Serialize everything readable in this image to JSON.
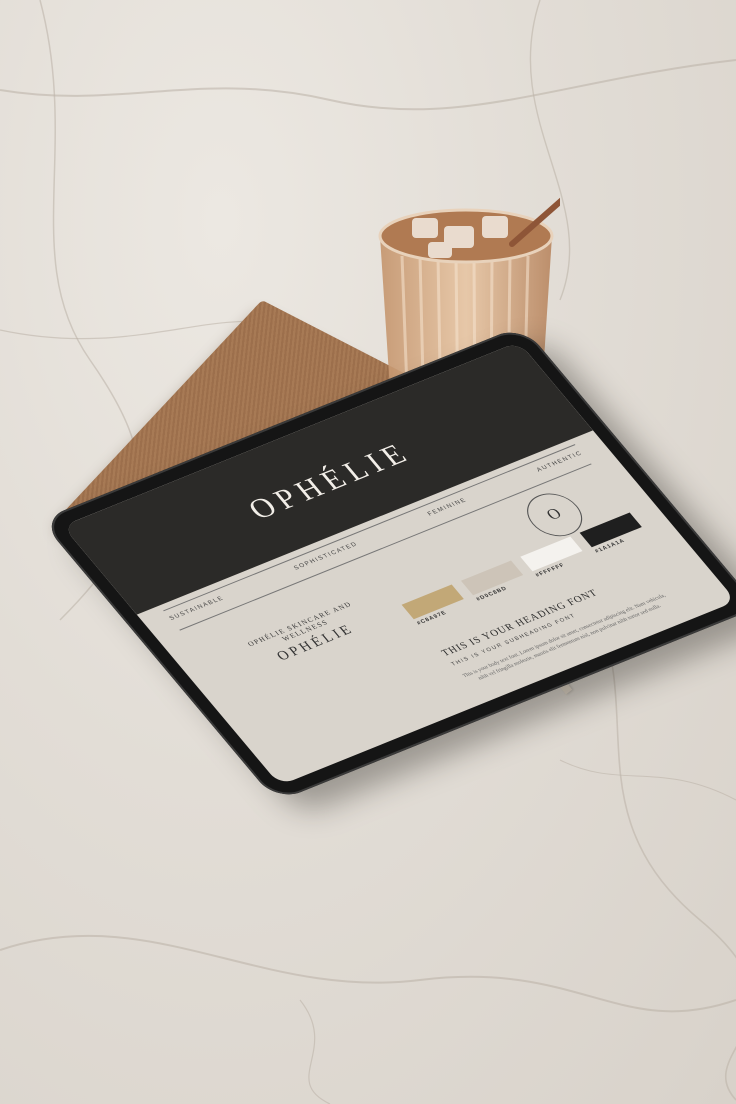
{
  "tablet": {
    "brand_name": "OPHÉLIE",
    "nav": [
      "SUSTAINABLE",
      "SOPHISTICATED",
      "FEMININE",
      "AUTHENTIC"
    ],
    "seal_letter": "O",
    "logo_tagline": "OPHÉLIE SKINCARE AND WELLNESS",
    "logo_name": "OPHÉLIE",
    "swatches": [
      {
        "label": "#C8A97E",
        "color": "#c2a877"
      },
      {
        "label": "#D0C8BD",
        "color": "#cdc4b8"
      },
      {
        "label": "#FFFFFF",
        "color": "#f4f2ee"
      },
      {
        "label": "#1A1A1A",
        "color": "#1f1f1f"
      }
    ],
    "heading": "THIS IS YOUR HEADING FONT",
    "subheading": "THIS IS YOUR SUBHEADING FONT",
    "body_text": "This is your body text font. Lorem ipsum dolor sit amet, consectetur adipiscing elit. Nam vehicula, nibh vel fringilla molestie, mauris elit fermentum nisl, non pulvinar nibh tortor sed nulla."
  },
  "colors": {
    "marble": "#e4dfd8",
    "notebook": "#a57752",
    "tablet_bezel": "#151515",
    "screen_header": "#2b2a28",
    "screen_bg": "#d9d4cc"
  }
}
